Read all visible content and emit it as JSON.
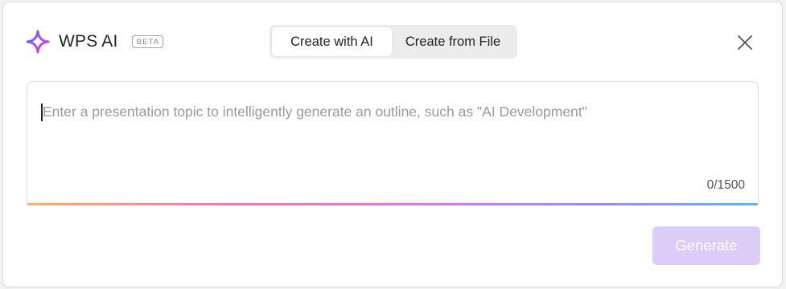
{
  "brand": {
    "name": "WPS AI",
    "badge": "BETA",
    "icon": "sparkle-icon",
    "icon_gradient": [
      "#4a6cf7",
      "#b34ee8",
      "#e44ab8"
    ]
  },
  "tabs": [
    {
      "label": "Create with AI",
      "active": true
    },
    {
      "label": "Create from File",
      "active": false
    }
  ],
  "close": {
    "icon": "close-icon"
  },
  "topic_input": {
    "value": "",
    "placeholder": "Enter a presentation topic to intelligently generate an outline, such as \"AI Development\"",
    "count_label": "0/1500"
  },
  "generate": {
    "label": "Generate",
    "enabled": false,
    "color": "#dcccf8"
  }
}
